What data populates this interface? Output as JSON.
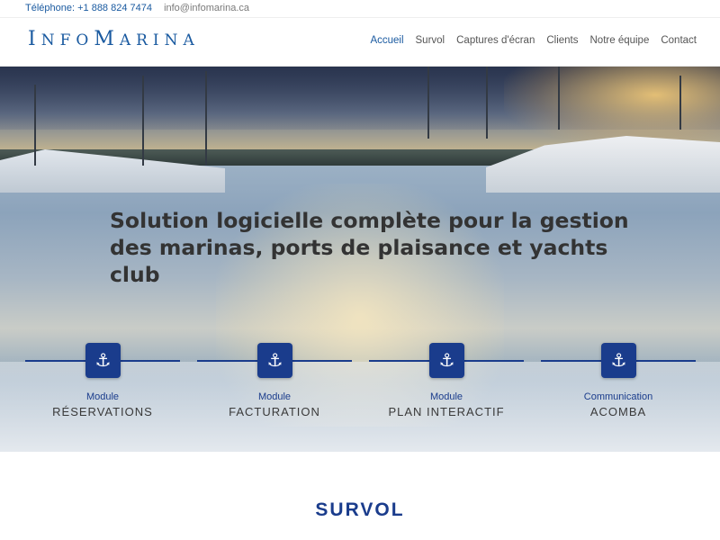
{
  "contact": {
    "phone": "Téléphone: +1 888 824 7474",
    "email": "info@infomarina.ca"
  },
  "brand": {
    "logo_first": "I",
    "logo_rest_1": "NFO",
    "logo_second": "M",
    "logo_rest_2": "ARINA"
  },
  "nav": {
    "items": [
      "Accueil",
      "Survol",
      "Captures d'écran",
      "Clients",
      "Notre équipe",
      "Contact"
    ],
    "active": "Accueil"
  },
  "hero": {
    "headline_line1": "Solution logicielle complète pour la gestion",
    "headline_line2": "des marinas, ports de plaisance et yachts club"
  },
  "modules": [
    {
      "kicker": "Module",
      "title": "RÉSERVATIONS",
      "icon": "anchor-icon"
    },
    {
      "kicker": "Module",
      "title": "FACTURATION",
      "icon": "anchor-icon"
    },
    {
      "kicker": "Module",
      "title": "PLAN INTERACTIF",
      "icon": "anchor-icon"
    },
    {
      "kicker": "Communication",
      "title": "ACOMBA",
      "icon": "anchor-icon"
    }
  ],
  "section": {
    "title": "SURVOL"
  },
  "colors": {
    "brand_blue": "#1a5aa0",
    "module_blue": "#1a3c8c"
  }
}
